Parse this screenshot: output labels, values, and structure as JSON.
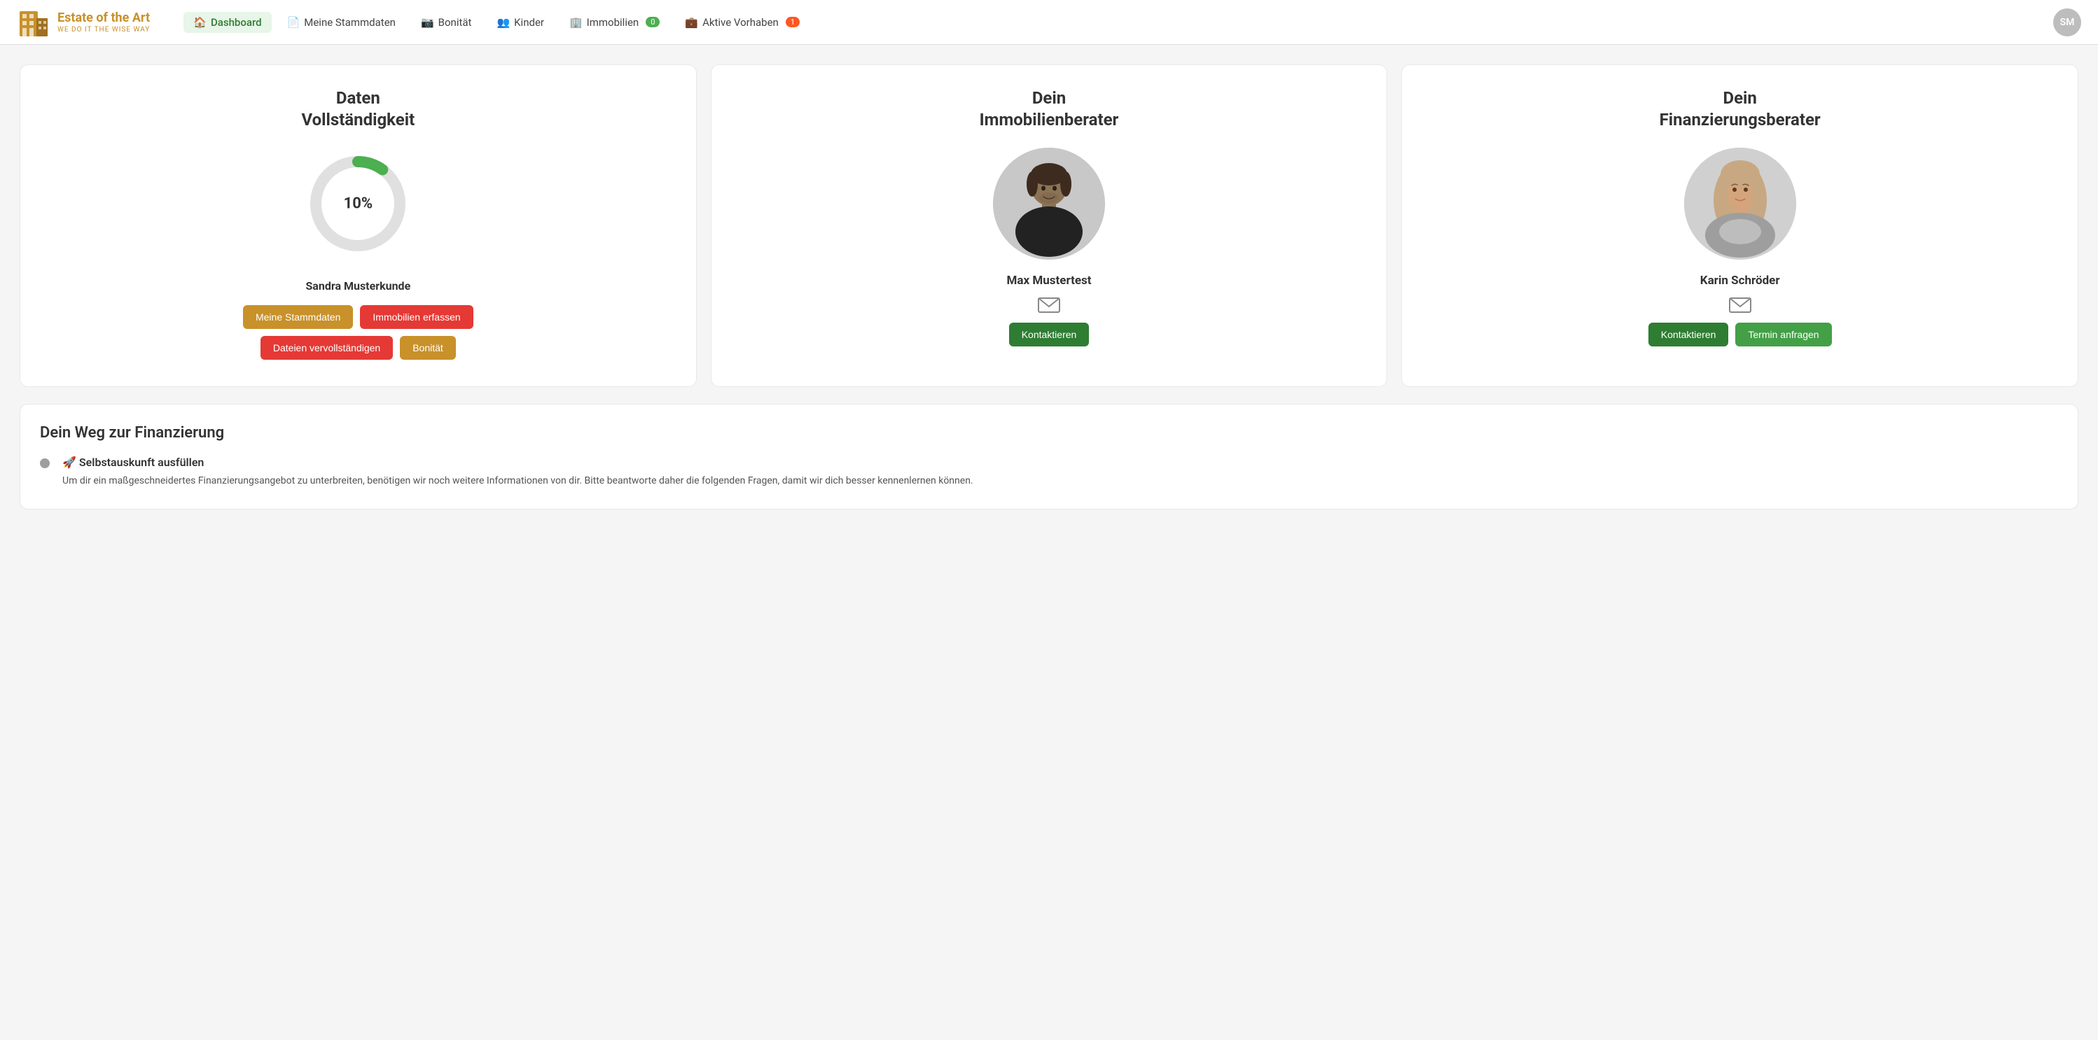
{
  "brand": {
    "title": "Estate of the Art",
    "subtitle": "WE DO IT THE WISE WAY"
  },
  "nav": {
    "items": [
      {
        "id": "dashboard",
        "label": "Dashboard",
        "icon": "🏠",
        "active": true,
        "badge": null
      },
      {
        "id": "stammdaten",
        "label": "Meine Stammdaten",
        "icon": "📄",
        "active": false,
        "badge": null
      },
      {
        "id": "bonitaet",
        "label": "Bonität",
        "icon": "📷",
        "active": false,
        "badge": null
      },
      {
        "id": "kinder",
        "label": "Kinder",
        "icon": "👥",
        "active": false,
        "badge": null
      },
      {
        "id": "immobilien",
        "label": "Immobilien",
        "icon": "🏢",
        "active": false,
        "badge": "0",
        "badge_color": "green"
      },
      {
        "id": "vorhaben",
        "label": "Aktive Vorhaben",
        "icon": "💼",
        "active": false,
        "badge": "1",
        "badge_color": "orange"
      }
    ],
    "avatar": "SM"
  },
  "cards": {
    "data_completeness": {
      "title": "Daten\nVollständigkeit",
      "percent": 10,
      "percent_label": "10%",
      "person_name": "Sandra Musterkunde",
      "buttons": [
        {
          "label": "Meine Stammdaten",
          "style": "orange"
        },
        {
          "label": "Immobilien erfassen",
          "style": "red"
        },
        {
          "label": "Dateien vervollständigen",
          "style": "red"
        },
        {
          "label": "Bonität",
          "style": "orange"
        }
      ]
    },
    "immobilien_advisor": {
      "title": "Dein\nImmobilienberater",
      "name": "Max Mustertest",
      "button": "Kontaktieren"
    },
    "finanzierungs_advisor": {
      "title": "Dein\nFinanzierungsberater",
      "name": "Karin Schröder",
      "buttons": [
        "Kontaktieren",
        "Termin anfragen"
      ]
    }
  },
  "finanzierung": {
    "title": "Dein Weg zur Finanzierung",
    "steps": [
      {
        "emoji": "🚀",
        "title": "Selbstauskunft ausfüllen",
        "description": "Um dir ein maßgeschneidertes Finanzierungsangebot zu unterbreiten, benötigen wir noch weitere Informationen von dir. Bitte beantworte daher die folgenden Fragen, damit wir dich besser kennenlernen können."
      }
    ]
  }
}
